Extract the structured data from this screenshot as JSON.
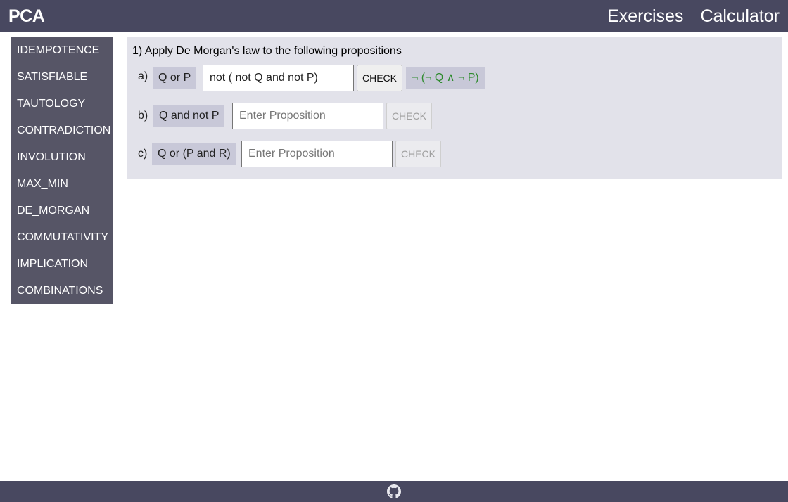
{
  "app": {
    "brand": "PCA"
  },
  "nav": {
    "items": [
      {
        "label": "Exercises"
      },
      {
        "label": "Calculator"
      }
    ]
  },
  "sidebar": {
    "items": [
      {
        "label": "IDEMPOTENCE"
      },
      {
        "label": "SATISFIABLE"
      },
      {
        "label": "TAUTOLOGY"
      },
      {
        "label": "CONTRADICTION"
      },
      {
        "label": "INVOLUTION"
      },
      {
        "label": "MAX_MIN"
      },
      {
        "label": "DE_MORGAN"
      },
      {
        "label": "COMMUTATIVITY"
      },
      {
        "label": "IMPLICATION"
      },
      {
        "label": "COMBINATIONS"
      }
    ]
  },
  "exercise": {
    "title": "1) Apply De Morgan's law to the following propositions",
    "rows": [
      {
        "label": "a)",
        "proposition": "Q or P",
        "input_value": "not ( not Q and not P)",
        "input_placeholder": "Enter Proposition",
        "button_label": "CHECK",
        "button_enabled": true,
        "result": "¬ (¬ Q ∧ ¬ P)"
      },
      {
        "label": "b)",
        "proposition": "Q and not P",
        "input_value": "",
        "input_placeholder": "Enter Proposition",
        "button_label": "CHECK",
        "button_enabled": false
      },
      {
        "label": "c)",
        "proposition": "Q or (P and R)",
        "input_value": "",
        "input_placeholder": "Enter Proposition",
        "button_label": "CHECK",
        "button_enabled": false
      }
    ]
  },
  "colors": {
    "header_bg": "#484860",
    "sidebar_bg": "#565566",
    "panel_bg": "#e2e2ea",
    "chip_bg": "#c8c8d8",
    "result_text": "#2e8b2e"
  },
  "footer": {
    "icon": "github-icon"
  }
}
